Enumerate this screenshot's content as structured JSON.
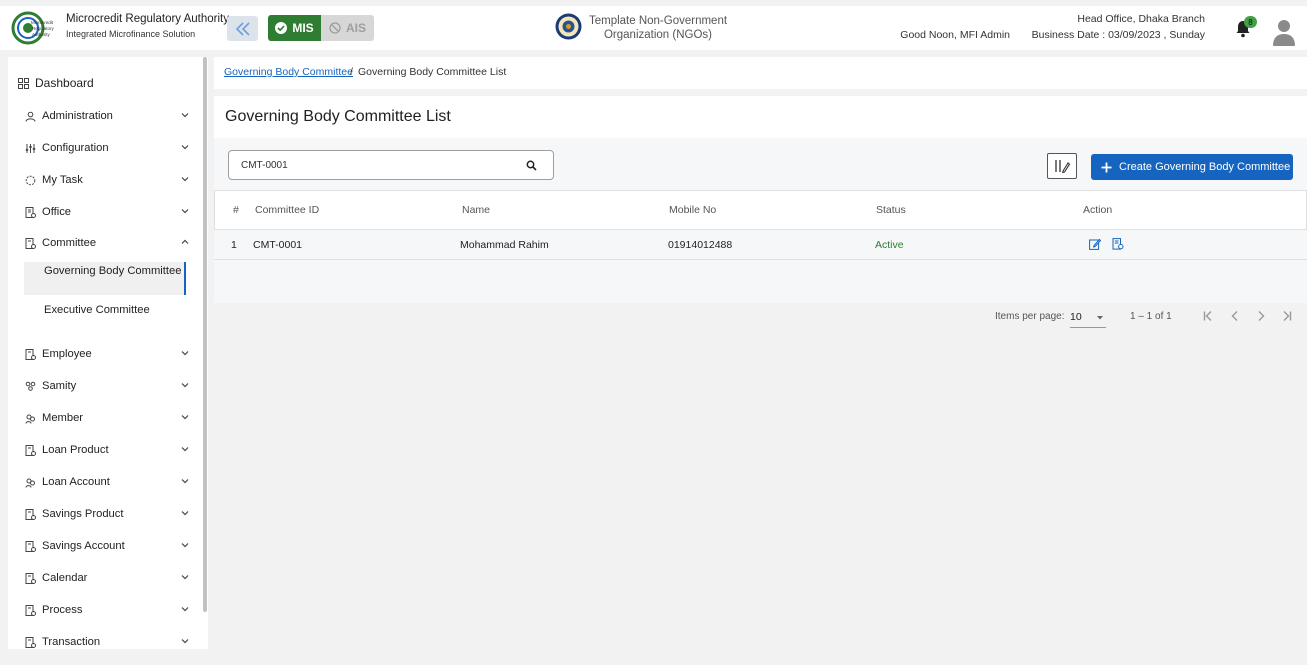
{
  "header": {
    "brand_title": "Microcredit Regulatory Authority",
    "brand_subtitle": "Integrated Microfinance Solution",
    "logo_text": [
      "Microcredit",
      "Regulatory",
      "Authority"
    ],
    "mis_label": "MIS",
    "ais_label": "AIS",
    "org_name": "Template Non-Government Organization (NGOs)",
    "greeting": "Good Noon, MFI Admin",
    "branch": "Head Office, Dhaka Branch",
    "business_date": "Business Date : 03/09/2023 , Sunday",
    "notification_count": "8"
  },
  "sidebar": {
    "dashboard": "Dashboard",
    "items": [
      {
        "label": "Administration",
        "icon": "admin-icon"
      },
      {
        "label": "Configuration",
        "icon": "sliders-icon"
      },
      {
        "label": "My Task",
        "icon": "task-icon"
      },
      {
        "label": "Office",
        "icon": "office-icon"
      },
      {
        "label": "Committee",
        "icon": "committee-icon"
      },
      {
        "label": "Employee",
        "icon": "employee-icon"
      },
      {
        "label": "Samity",
        "icon": "samity-icon"
      },
      {
        "label": "Member",
        "icon": "member-icon"
      },
      {
        "label": "Loan Product",
        "icon": "loan-product-icon"
      },
      {
        "label": "Loan Account",
        "icon": "loan-account-icon"
      },
      {
        "label": "Savings Product",
        "icon": "savings-product-icon"
      },
      {
        "label": "Savings Account",
        "icon": "savings-account-icon"
      },
      {
        "label": "Calendar",
        "icon": "calendar-icon"
      },
      {
        "label": "Process",
        "icon": "process-icon"
      },
      {
        "label": "Transaction",
        "icon": "transaction-icon"
      }
    ],
    "committee_sub": [
      "Governing Body Committee",
      "Executive Committee"
    ]
  },
  "breadcrumb": {
    "parent": "Governing Body Committee",
    "separator": "/",
    "current": "Governing Body Committee List"
  },
  "page": {
    "title": "Governing Body Committee List",
    "search_value": "CMT-0001",
    "create_button": "Create Governing Body Committee"
  },
  "table": {
    "columns": [
      "#",
      "Committee ID",
      "Name",
      "Mobile No",
      "Status",
      "Action"
    ],
    "rows": [
      {
        "index": "1",
        "committee_id": "CMT-0001",
        "name": "Mohammad Rahim",
        "mobile": "01914012488",
        "status": "Active"
      }
    ]
  },
  "paginator": {
    "items_per_page_label": "Items per page:",
    "items_per_page": "10",
    "range": "1 – 1 of 1"
  },
  "colors": {
    "primary": "#1565c0",
    "mis_green": "#2e7d32",
    "status_active": "#2e7d32"
  }
}
